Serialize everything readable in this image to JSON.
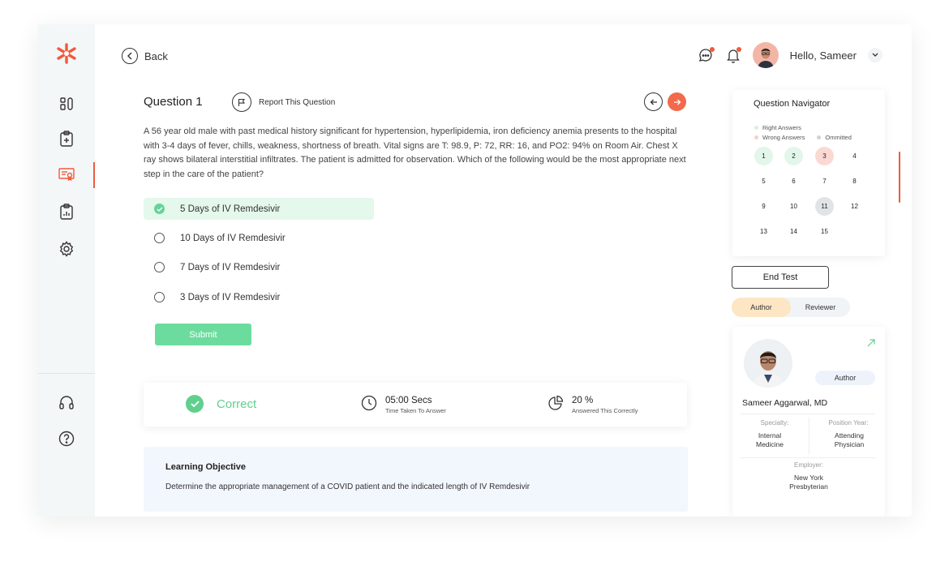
{
  "header": {
    "back_label": "Back",
    "greeting": "Hello, Sameer"
  },
  "question": {
    "title": "Question 1",
    "report_label": "Report This Question",
    "text": "A 56 year old male with past medical history significant for hypertension, hyperlipidemia, iron deficiency anemia presents to the hospital with 3-4 days of fever, chills, weakness, shortness of breath. Vital signs are T: 98.9, P: 72, RR: 16, and PO2: 94% on Room Air. Chest X ray shows bilateral interstitial infiltrates. The patient is admitted for observation. Which of the following would be the most appropriate next step in the care of the patient?",
    "options": [
      {
        "label": "5 Days of IV Remdesivir",
        "selected": true
      },
      {
        "label": "10 Days of IV Remdesivir",
        "selected": false
      },
      {
        "label": "7 Days of IV Remdesivir",
        "selected": false
      },
      {
        "label": "3 Days of IV Remdesivir",
        "selected": false
      }
    ],
    "submit_label": "Submit"
  },
  "result": {
    "status": "Correct",
    "time_value": "05:00  Secs",
    "time_caption": "Time Taken To Answer",
    "percent_value": "20 %",
    "percent_caption": "Answered This Correctly"
  },
  "learning_objective": {
    "title": "Learning Objective",
    "text": "Determine the appropriate management of a COVID patient and the indicated length of IV Remdesivir"
  },
  "navigator": {
    "title": "Question Navigator",
    "legend_right": "Right Answers",
    "legend_wrong": "Wrong Answers",
    "legend_omitted": "Ommitted",
    "numbers": [
      "1",
      "2",
      "3",
      "4",
      "5",
      "6",
      "7",
      "8",
      "9",
      "10",
      "11",
      "12",
      "13",
      "14",
      "15"
    ],
    "status": [
      "right",
      "right",
      "wrong",
      "none",
      "none",
      "none",
      "none",
      "none",
      "none",
      "none",
      "omitted",
      "none",
      "none",
      "none",
      "none"
    ]
  },
  "end_test_label": "End Test",
  "tabs": {
    "author": "Author",
    "reviewer": "Reviewer"
  },
  "author": {
    "badge": "Author",
    "name": "Sameer  Aggarwal, MD",
    "specialty_label": "Specialty:",
    "specialty_value": "Internal Medicine",
    "position_label": "Position Year:",
    "position_value": "Attending Physician",
    "employer_label": "Employer:",
    "employer_value": "New York Presbyterian"
  },
  "colors": {
    "accent": "#f05a3e",
    "success": "#5fd08d",
    "selected_bg": "#e4f8ec",
    "wrong_bg": "#fbd9d2",
    "right_bg": "#e2f6ea",
    "omitted_bg": "#e1e3e5"
  }
}
